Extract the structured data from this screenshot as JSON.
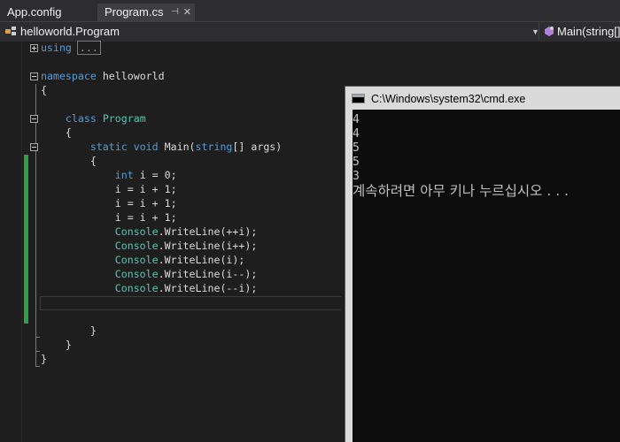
{
  "tabs": [
    {
      "label": "App.config",
      "active": false
    },
    {
      "label": "Program.cs",
      "active": true
    }
  ],
  "nav": {
    "class_selector": "helloworld.Program",
    "member_selector": "Main(string[]"
  },
  "code": {
    "using_keyword": "using",
    "using_collapsed": "...",
    "namespace_keyword": "namespace",
    "namespace_name": "helloworld",
    "open_brace": "{",
    "close_brace": "}",
    "class_keyword": "class",
    "class_name": "Program",
    "static_keyword": "static",
    "void_keyword": "void",
    "main_name": "Main(",
    "string_keyword": "string",
    "main_params": "[] args)",
    "int_keyword": "int",
    "decl_rest": " i = 0;",
    "assign1": "i = i + 1;",
    "assign2": "i = i + 1;",
    "assign3": "i = i + 1;",
    "console_type": "Console",
    "call1": ".WriteLine(++i);",
    "call2": ".WriteLine(i++);",
    "call3": ".WriteLine(i);",
    "call4": ".WriteLine(i--);",
    "call5": ".WriteLine(--i);"
  },
  "console": {
    "title": "C:\\Windows\\system32\\cmd.exe",
    "output": [
      "4",
      "4",
      "5",
      "5",
      "3"
    ],
    "prompt": "계속하려면 아무 키나 누르십시오 . . ."
  },
  "colors": {
    "keyword": "#569cd6",
    "type": "#4ec9b0",
    "change_bar": "#2ea043",
    "editor_bg": "#1e1e1e",
    "console_bg": "#0c0c0c"
  },
  "icons": [
    "tab-pin-icon",
    "tab-close-icon",
    "class-icon",
    "method-icon",
    "dropdown-arrow-icon",
    "cmd-window-icon",
    "fold-plus-icon",
    "fold-minus-icon"
  ]
}
